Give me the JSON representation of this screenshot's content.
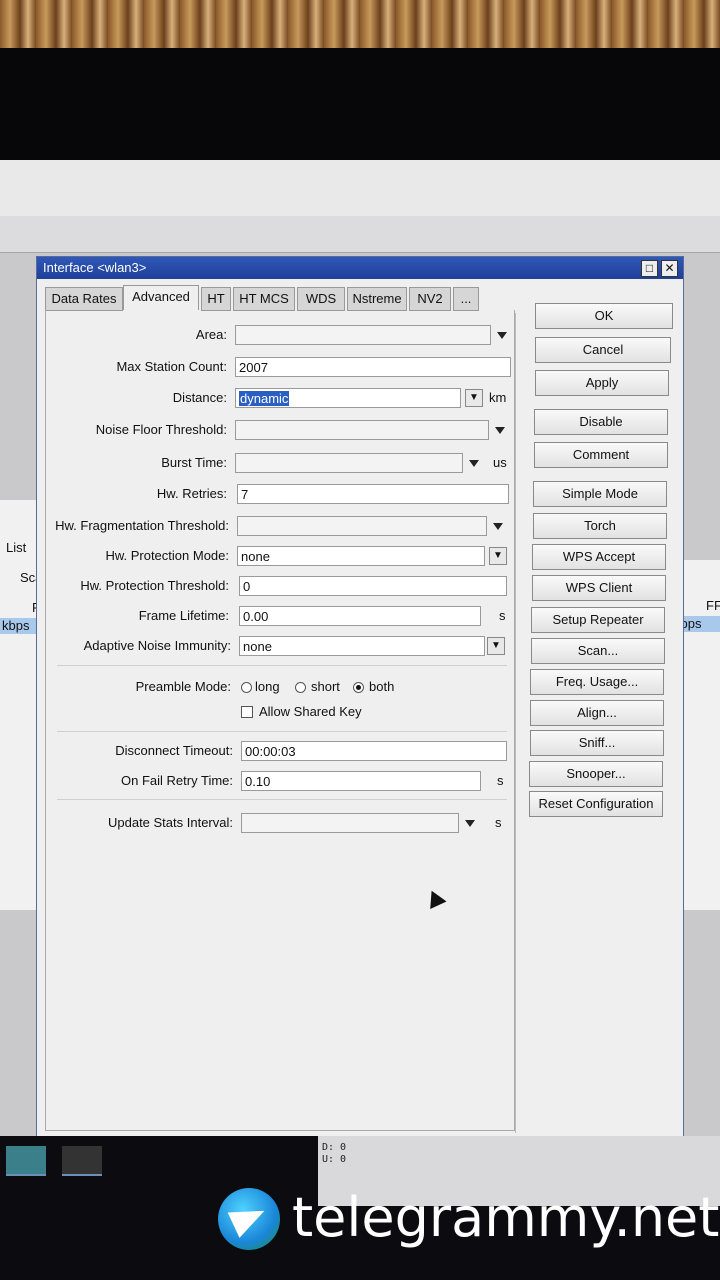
{
  "window": {
    "title": "Interface <wlan3>",
    "maximize_icon": "maximize-icon",
    "close_icon": "close-icon"
  },
  "tabs": [
    "Data Rates",
    "Advanced",
    "HT",
    "HT MCS",
    "WDS",
    "Nstreme",
    "NV2",
    "..."
  ],
  "active_tab": "Advanced",
  "fields": {
    "area": {
      "label": "Area:",
      "value": ""
    },
    "max_station_count": {
      "label": "Max Station Count:",
      "value": "2007"
    },
    "distance": {
      "label": "Distance:",
      "value": "dynamic",
      "unit": "km"
    },
    "noise_floor_threshold": {
      "label": "Noise Floor Threshold:",
      "value": ""
    },
    "burst_time": {
      "label": "Burst Time:",
      "value": "",
      "unit": "us"
    },
    "hw_retries": {
      "label": "Hw. Retries:",
      "value": "7"
    },
    "hw_fragmentation_threshold": {
      "label": "Hw. Fragmentation Threshold:",
      "value": ""
    },
    "hw_protection_mode": {
      "label": "Hw. Protection Mode:",
      "value": "none"
    },
    "hw_protection_threshold": {
      "label": "Hw. Protection Threshold:",
      "value": "0"
    },
    "frame_lifetime": {
      "label": "Frame Lifetime:",
      "value": "0.00",
      "unit": "s"
    },
    "adaptive_noise_immunity": {
      "label": "Adaptive Noise Immunity:",
      "value": "none"
    },
    "preamble_mode": {
      "label": "Preamble Mode:",
      "options": [
        "long",
        "short",
        "both"
      ],
      "selected": "both"
    },
    "allow_shared_key": {
      "label": "Allow Shared Key",
      "checked": false
    },
    "disconnect_timeout": {
      "label": "Disconnect Timeout:",
      "value": "00:00:03"
    },
    "on_fail_retry_time": {
      "label": "On Fail Retry Time:",
      "value": "0.10",
      "unit": "s"
    },
    "update_stats_interval": {
      "label": "Update Stats Interval:",
      "value": "",
      "unit": "s"
    }
  },
  "buttons": [
    "OK",
    "Cancel",
    "Apply",
    "Disable",
    "Comment",
    "Simple Mode",
    "Torch",
    "WPS Accept",
    "WPS Client",
    "Setup Repeater",
    "Scan...",
    "Freq. Usage...",
    "Align...",
    "Sniff...",
    "Snooper...",
    "Reset Configuration"
  ],
  "background": {
    "list_tab": "List",
    "scan_btn": "Sca",
    "col_r": "R",
    "col_ff": "FF",
    "rate_left": "kbps",
    "rate_right": "kbps"
  },
  "tray": {
    "d": "D: 0",
    "u": "U: 0"
  },
  "watermark": "telegrammy.net"
}
